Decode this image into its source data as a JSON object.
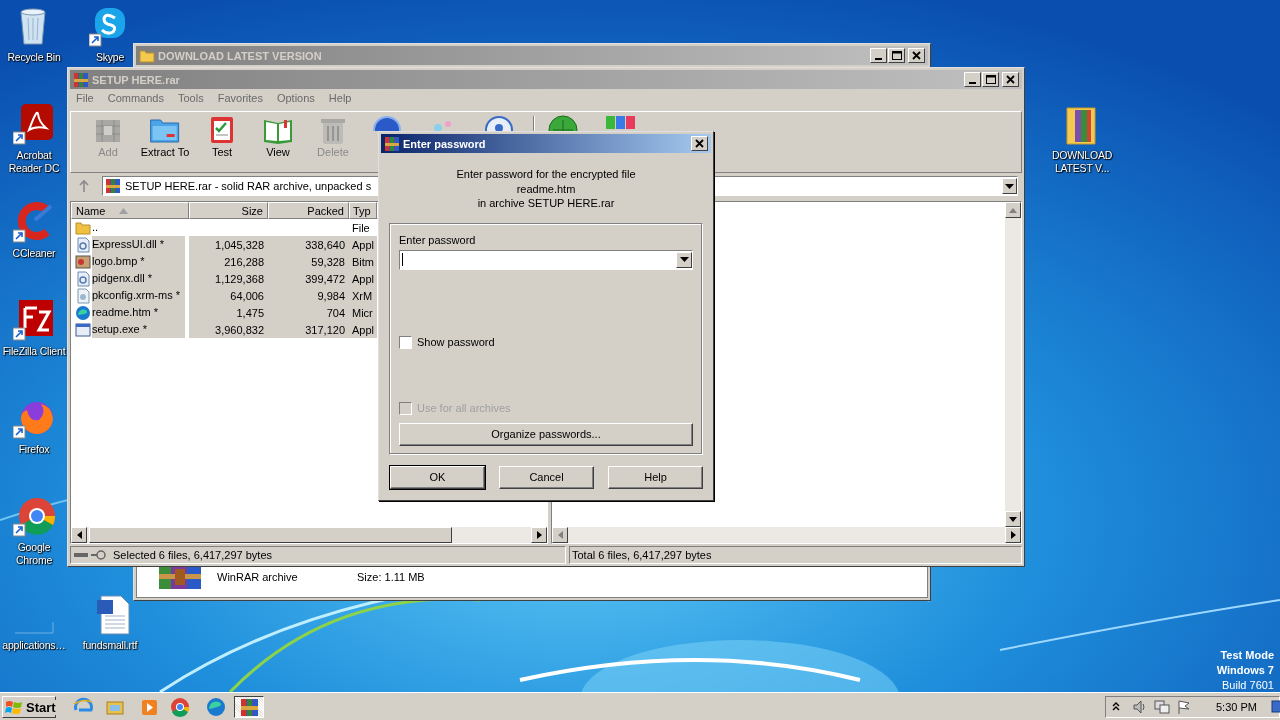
{
  "desktop_icons": [
    {
      "label": "Recycle Bin"
    },
    {
      "label": "Skype"
    },
    {
      "label": "Acrobat Reader DC"
    },
    {
      "label": "CCleaner"
    },
    {
      "label": "FileZilla Client"
    },
    {
      "label": "Firefox"
    },
    {
      "label": "Google Chrome"
    },
    {
      "label": "applications…"
    },
    {
      "label": "fundsmall.rtf"
    },
    {
      "label": "DOWNLOAD LATEST V..."
    }
  ],
  "back_window": {
    "title": "DOWNLOAD LATEST VERSION",
    "file_type": "WinRAR archive",
    "file_size": "Size: 1.11 MB"
  },
  "archive_window": {
    "title": "SETUP HERE.rar",
    "menu": [
      "File",
      "Commands",
      "Tools",
      "Favorites",
      "Options",
      "Help"
    ],
    "toolbar": [
      {
        "label": "Add",
        "disabled": true
      },
      {
        "label": "Extract To",
        "disabled": false
      },
      {
        "label": "Test",
        "disabled": false
      },
      {
        "label": "View",
        "disabled": false
      },
      {
        "label": "Delete",
        "disabled": true
      }
    ],
    "address": "SETUP HERE.rar - solid RAR archive, unpacked s",
    "columns": [
      "Name",
      "Size",
      "Packed",
      "Typ"
    ],
    "rows": [
      {
        "name": "..",
        "size": "",
        "packed": "",
        "type": "File",
        "selected": false
      },
      {
        "name": "ExpressUI.dll *",
        "size": "1,045,328",
        "packed": "338,640",
        "type": "Appl",
        "selected": true
      },
      {
        "name": "logo.bmp *",
        "size": "216,288",
        "packed": "59,328",
        "type": "Bitm",
        "selected": true
      },
      {
        "name": "pidgenx.dll *",
        "size": "1,129,368",
        "packed": "399,472",
        "type": "Appl",
        "selected": true
      },
      {
        "name": "pkconfig.xrm-ms *",
        "size": "64,006",
        "packed": "9,984",
        "type": "XrM",
        "selected": true
      },
      {
        "name": "readme.htm *",
        "size": "1,475",
        "packed": "704",
        "type": "Micr",
        "selected": true
      },
      {
        "name": "setup.exe *",
        "size": "3,960,832",
        "packed": "317,120",
        "type": "Appl",
        "selected": true
      }
    ],
    "status_left": "Selected 6 files, 6,417,297 bytes",
    "status_right": "Total 6 files, 6,417,297 bytes"
  },
  "dialog": {
    "title": "Enter password",
    "message": [
      "Enter password for the encrypted file",
      "readme.htm",
      "in archive SETUP HERE.rar"
    ],
    "field_label": "Enter password",
    "checkboxes": [
      {
        "label": "Show password",
        "checked": false,
        "disabled": false
      },
      {
        "label": "Use for all archives",
        "checked": false,
        "disabled": true
      }
    ],
    "organize_button": "Organize passwords...",
    "buttons": [
      {
        "label": "OK",
        "default": true
      },
      {
        "label": "Cancel",
        "default": false
      },
      {
        "label": "Help",
        "default": false
      }
    ]
  },
  "taskbar": {
    "start": "Start",
    "apps": [
      {
        "active": false
      },
      {
        "active": false
      },
      {
        "active": false
      },
      {
        "active": false
      },
      {
        "active": false
      },
      {
        "active": true
      }
    ],
    "clock": "5:30 PM"
  },
  "os_info": [
    "Test Mode",
    "Windows 7",
    "Build 7601"
  ]
}
